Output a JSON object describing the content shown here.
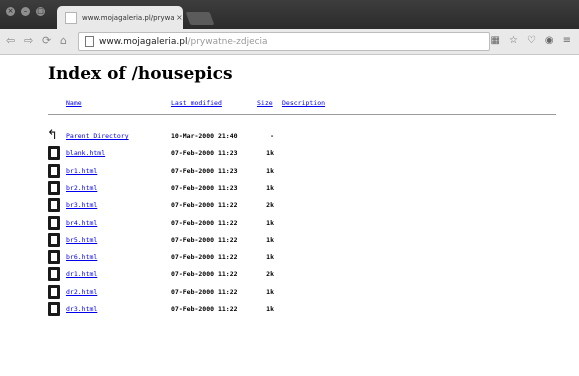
{
  "window": {
    "controls": [
      "×",
      "–",
      "□"
    ],
    "tab": {
      "title": "www.mojagaleria.pl/prywa",
      "close": "×"
    }
  },
  "toolbar": {
    "back": "⇦",
    "forward": "⇨",
    "reload": "⟳",
    "home": "⌂",
    "url_domain": "www.mojagaleria.pl",
    "url_path": "/prywatne-zdjecia",
    "extensions": [
      "▦",
      "☆",
      "♡",
      "◉",
      "≡"
    ]
  },
  "page": {
    "heading": "Index of /housepics",
    "columns": {
      "name": "Name",
      "modified": "Last modified",
      "size": "Size",
      "description": "Description"
    },
    "rows": [
      {
        "name": "Parent Directory",
        "modified": "10-Mar-2000 21:40",
        "size": "-",
        "icon": "back-icon"
      },
      {
        "name": "blank.html",
        "modified": "07-Feb-2000 11:23",
        "size": "1k",
        "icon": "file-icon"
      },
      {
        "name": "br1.html",
        "modified": "07-Feb-2000 11:23",
        "size": "1k",
        "icon": "file-icon"
      },
      {
        "name": "br2.html",
        "modified": "07-Feb-2000 11:23",
        "size": "1k",
        "icon": "file-icon"
      },
      {
        "name": "br3.html",
        "modified": "07-Feb-2000 11:22",
        "size": "2k",
        "icon": "file-icon"
      },
      {
        "name": "br4.html",
        "modified": "07-Feb-2000 11:22",
        "size": "1k",
        "icon": "file-icon"
      },
      {
        "name": "br5.html",
        "modified": "07-Feb-2000 11:22",
        "size": "1k",
        "icon": "file-icon"
      },
      {
        "name": "br6.html",
        "modified": "07-Feb-2000 11:22",
        "size": "1k",
        "icon": "file-icon"
      },
      {
        "name": "dr1.html",
        "modified": "07-Feb-2000 11:22",
        "size": "2k",
        "icon": "file-icon"
      },
      {
        "name": "dr2.html",
        "modified": "07-Feb-2000 11:22",
        "size": "1k",
        "icon": "file-icon"
      },
      {
        "name": "dr3.html",
        "modified": "07-Feb-2000 11:22",
        "size": "1k",
        "icon": "file-icon"
      }
    ]
  },
  "colors": {
    "link": "#0000ee",
    "titlebar": "#2f2f2f",
    "toolbar": "#e9e9e9"
  }
}
